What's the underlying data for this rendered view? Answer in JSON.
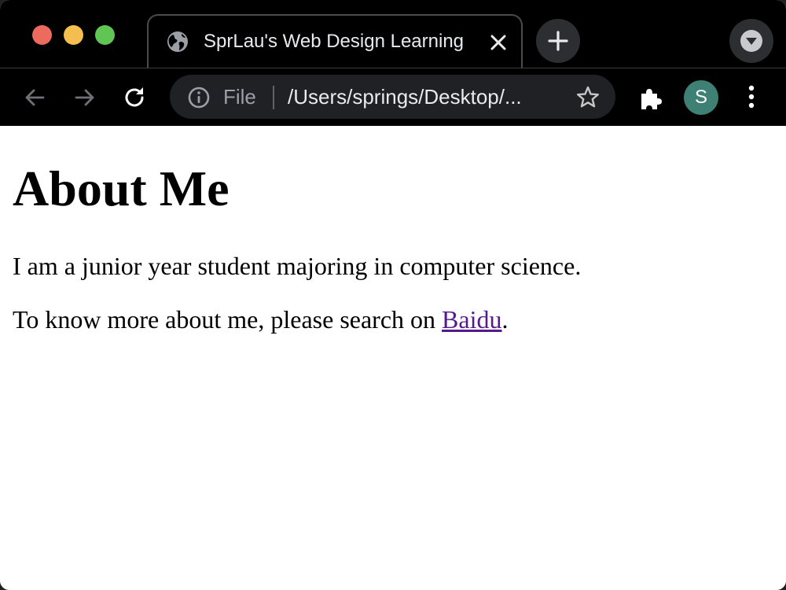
{
  "browser": {
    "tab": {
      "title": "SprLau's Web Design Learning"
    },
    "omnibox": {
      "scheme_label": "File",
      "url": "/Users/springs/Desktop/..."
    },
    "profile": {
      "initial": "S",
      "color": "#3e8074"
    },
    "icons": {
      "tab_favicon": "globe-icon",
      "tab_close": "close-icon",
      "new_tab": "plus-icon",
      "tab_search": "chevron-down-icon",
      "back": "arrow-left-icon",
      "forward": "arrow-right-icon",
      "reload": "reload-icon",
      "site_info": "info-icon",
      "bookmark": "star-icon",
      "extensions": "puzzle-icon",
      "menu": "kebab-menu-icon"
    }
  },
  "page": {
    "heading": "About Me",
    "paragraph1": "I am a junior year student majoring in computer science.",
    "paragraph2_prefix": "To know more about me, please search on ",
    "link_text": "Baidu",
    "paragraph2_suffix": ".",
    "link_color": "#551a8b"
  }
}
